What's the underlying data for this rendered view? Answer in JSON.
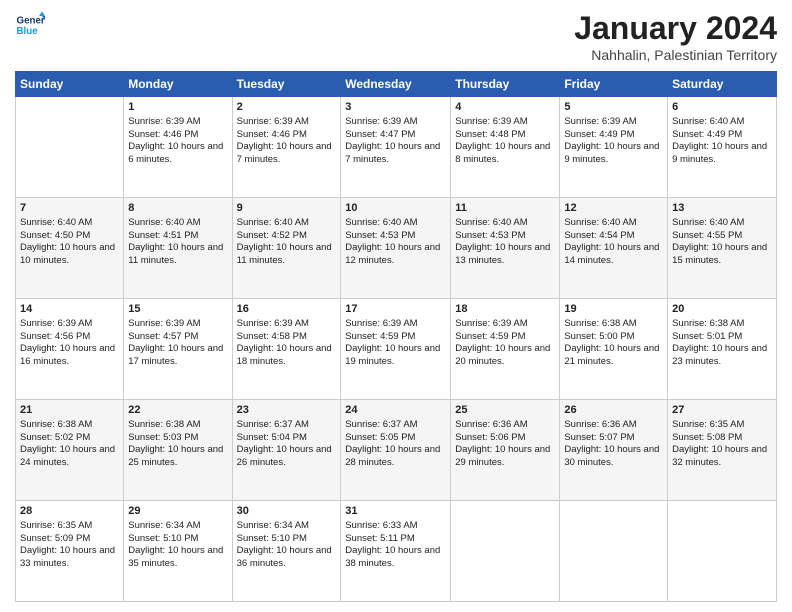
{
  "logo": {
    "line1": "General",
    "line2": "Blue"
  },
  "title": "January 2024",
  "location": "Nahhalin, Palestinian Territory",
  "days_header": [
    "Sunday",
    "Monday",
    "Tuesday",
    "Wednesday",
    "Thursday",
    "Friday",
    "Saturday"
  ],
  "weeks": [
    [
      {
        "day": "",
        "sunrise": "",
        "sunset": "",
        "daylight": ""
      },
      {
        "day": "1",
        "sunrise": "Sunrise: 6:39 AM",
        "sunset": "Sunset: 4:46 PM",
        "daylight": "Daylight: 10 hours and 6 minutes."
      },
      {
        "day": "2",
        "sunrise": "Sunrise: 6:39 AM",
        "sunset": "Sunset: 4:46 PM",
        "daylight": "Daylight: 10 hours and 7 minutes."
      },
      {
        "day": "3",
        "sunrise": "Sunrise: 6:39 AM",
        "sunset": "Sunset: 4:47 PM",
        "daylight": "Daylight: 10 hours and 7 minutes."
      },
      {
        "day": "4",
        "sunrise": "Sunrise: 6:39 AM",
        "sunset": "Sunset: 4:48 PM",
        "daylight": "Daylight: 10 hours and 8 minutes."
      },
      {
        "day": "5",
        "sunrise": "Sunrise: 6:39 AM",
        "sunset": "Sunset: 4:49 PM",
        "daylight": "Daylight: 10 hours and 9 minutes."
      },
      {
        "day": "6",
        "sunrise": "Sunrise: 6:40 AM",
        "sunset": "Sunset: 4:49 PM",
        "daylight": "Daylight: 10 hours and 9 minutes."
      }
    ],
    [
      {
        "day": "7",
        "sunrise": "Sunrise: 6:40 AM",
        "sunset": "Sunset: 4:50 PM",
        "daylight": "Daylight: 10 hours and 10 minutes."
      },
      {
        "day": "8",
        "sunrise": "Sunrise: 6:40 AM",
        "sunset": "Sunset: 4:51 PM",
        "daylight": "Daylight: 10 hours and 11 minutes."
      },
      {
        "day": "9",
        "sunrise": "Sunrise: 6:40 AM",
        "sunset": "Sunset: 4:52 PM",
        "daylight": "Daylight: 10 hours and 11 minutes."
      },
      {
        "day": "10",
        "sunrise": "Sunrise: 6:40 AM",
        "sunset": "Sunset: 4:53 PM",
        "daylight": "Daylight: 10 hours and 12 minutes."
      },
      {
        "day": "11",
        "sunrise": "Sunrise: 6:40 AM",
        "sunset": "Sunset: 4:53 PM",
        "daylight": "Daylight: 10 hours and 13 minutes."
      },
      {
        "day": "12",
        "sunrise": "Sunrise: 6:40 AM",
        "sunset": "Sunset: 4:54 PM",
        "daylight": "Daylight: 10 hours and 14 minutes."
      },
      {
        "day": "13",
        "sunrise": "Sunrise: 6:40 AM",
        "sunset": "Sunset: 4:55 PM",
        "daylight": "Daylight: 10 hours and 15 minutes."
      }
    ],
    [
      {
        "day": "14",
        "sunrise": "Sunrise: 6:39 AM",
        "sunset": "Sunset: 4:56 PM",
        "daylight": "Daylight: 10 hours and 16 minutes."
      },
      {
        "day": "15",
        "sunrise": "Sunrise: 6:39 AM",
        "sunset": "Sunset: 4:57 PM",
        "daylight": "Daylight: 10 hours and 17 minutes."
      },
      {
        "day": "16",
        "sunrise": "Sunrise: 6:39 AM",
        "sunset": "Sunset: 4:58 PM",
        "daylight": "Daylight: 10 hours and 18 minutes."
      },
      {
        "day": "17",
        "sunrise": "Sunrise: 6:39 AM",
        "sunset": "Sunset: 4:59 PM",
        "daylight": "Daylight: 10 hours and 19 minutes."
      },
      {
        "day": "18",
        "sunrise": "Sunrise: 6:39 AM",
        "sunset": "Sunset: 4:59 PM",
        "daylight": "Daylight: 10 hours and 20 minutes."
      },
      {
        "day": "19",
        "sunrise": "Sunrise: 6:38 AM",
        "sunset": "Sunset: 5:00 PM",
        "daylight": "Daylight: 10 hours and 21 minutes."
      },
      {
        "day": "20",
        "sunrise": "Sunrise: 6:38 AM",
        "sunset": "Sunset: 5:01 PM",
        "daylight": "Daylight: 10 hours and 23 minutes."
      }
    ],
    [
      {
        "day": "21",
        "sunrise": "Sunrise: 6:38 AM",
        "sunset": "Sunset: 5:02 PM",
        "daylight": "Daylight: 10 hours and 24 minutes."
      },
      {
        "day": "22",
        "sunrise": "Sunrise: 6:38 AM",
        "sunset": "Sunset: 5:03 PM",
        "daylight": "Daylight: 10 hours and 25 minutes."
      },
      {
        "day": "23",
        "sunrise": "Sunrise: 6:37 AM",
        "sunset": "Sunset: 5:04 PM",
        "daylight": "Daylight: 10 hours and 26 minutes."
      },
      {
        "day": "24",
        "sunrise": "Sunrise: 6:37 AM",
        "sunset": "Sunset: 5:05 PM",
        "daylight": "Daylight: 10 hours and 28 minutes."
      },
      {
        "day": "25",
        "sunrise": "Sunrise: 6:36 AM",
        "sunset": "Sunset: 5:06 PM",
        "daylight": "Daylight: 10 hours and 29 minutes."
      },
      {
        "day": "26",
        "sunrise": "Sunrise: 6:36 AM",
        "sunset": "Sunset: 5:07 PM",
        "daylight": "Daylight: 10 hours and 30 minutes."
      },
      {
        "day": "27",
        "sunrise": "Sunrise: 6:35 AM",
        "sunset": "Sunset: 5:08 PM",
        "daylight": "Daylight: 10 hours and 32 minutes."
      }
    ],
    [
      {
        "day": "28",
        "sunrise": "Sunrise: 6:35 AM",
        "sunset": "Sunset: 5:09 PM",
        "daylight": "Daylight: 10 hours and 33 minutes."
      },
      {
        "day": "29",
        "sunrise": "Sunrise: 6:34 AM",
        "sunset": "Sunset: 5:10 PM",
        "daylight": "Daylight: 10 hours and 35 minutes."
      },
      {
        "day": "30",
        "sunrise": "Sunrise: 6:34 AM",
        "sunset": "Sunset: 5:10 PM",
        "daylight": "Daylight: 10 hours and 36 minutes."
      },
      {
        "day": "31",
        "sunrise": "Sunrise: 6:33 AM",
        "sunset": "Sunset: 5:11 PM",
        "daylight": "Daylight: 10 hours and 38 minutes."
      },
      {
        "day": "",
        "sunrise": "",
        "sunset": "",
        "daylight": ""
      },
      {
        "day": "",
        "sunrise": "",
        "sunset": "",
        "daylight": ""
      },
      {
        "day": "",
        "sunrise": "",
        "sunset": "",
        "daylight": ""
      }
    ]
  ]
}
